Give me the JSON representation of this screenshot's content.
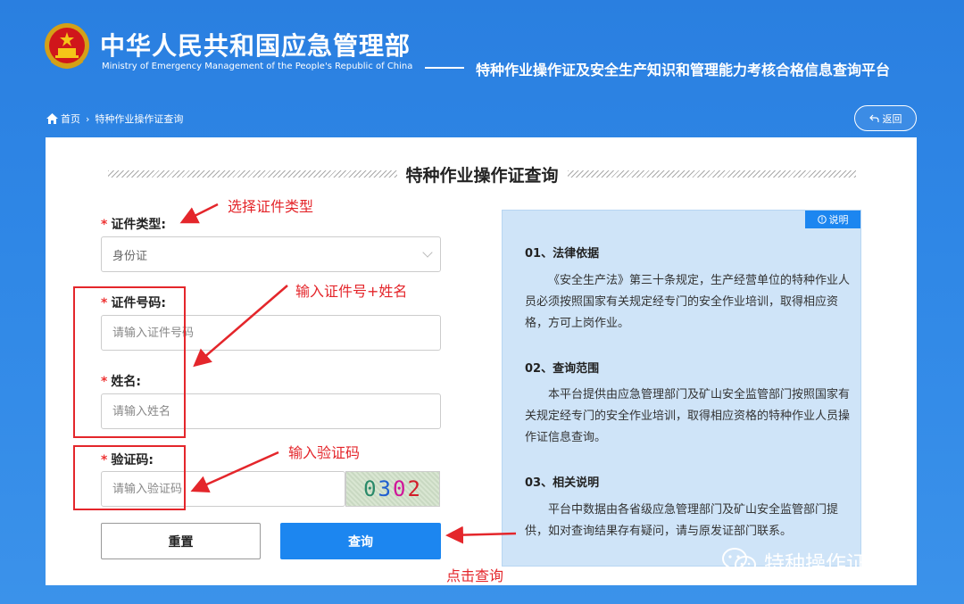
{
  "header": {
    "ministry_cn": "中华人民共和国应急管理部",
    "ministry_en": "Ministry of Emergency Management of the People's Republic of China",
    "platform_title": "特种作业操作证及安全生产知识和管理能力考核合格信息查询平台"
  },
  "breadcrumb": {
    "home": "首页",
    "separator": "›",
    "current": "特种作业操作证查询"
  },
  "back_button": "返回",
  "form": {
    "title": "特种作业操作证查询",
    "cert_type": {
      "label": "证件类型:",
      "value": "身份证"
    },
    "cert_no": {
      "label": "证件号码:",
      "placeholder": "请输入证件号码"
    },
    "name": {
      "label": "姓名:",
      "placeholder": "请输入姓名"
    },
    "captcha": {
      "label": "验证码:",
      "placeholder": "请输入验证码",
      "digits": [
        "0",
        "3",
        "0",
        "2"
      ]
    },
    "reset_button": "重置",
    "query_button": "查询",
    "required_mark": "*"
  },
  "note": {
    "badge": "说明",
    "sections": [
      {
        "title": "01、法律依据",
        "text": "《安全生产法》第三十条规定，生产经营单位的特种作业人员必须按照国家有关规定经专门的安全作业培训，取得相应资格，方可上岗作业。"
      },
      {
        "title": "02、查询范围",
        "text": "本平台提供由应急管理部门及矿山安全监管部门按照国家有关规定经专门的安全作业培训，取得相应资格的特种作业人员操作证信息查询。"
      },
      {
        "title": "03、相关说明",
        "text": "平台中数据由各省级应急管理部门及矿山安全监管部门提供，如对查询结果存有疑问，请与原发证部门联系。"
      }
    ]
  },
  "annotations": {
    "select_type": "选择证件类型",
    "input_no_name": "输入证件号+姓名",
    "input_captcha": "输入验证码",
    "click_query": "点击查询",
    "color": "#e4262b"
  },
  "watermark": "特种操作证百科",
  "colors": {
    "background": "#2f87e6",
    "accent": "#1c86f0",
    "note_bg": "#cfe4f8",
    "required": "#e33"
  }
}
